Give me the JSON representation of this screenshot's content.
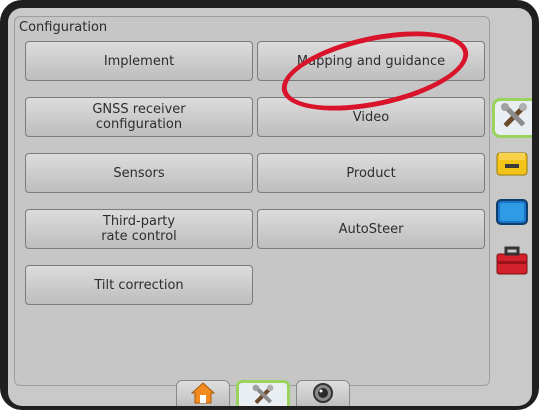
{
  "panel": {
    "title": "Configuration"
  },
  "buttons": {
    "implement": "Implement",
    "mapping": "Mapping and guidance",
    "gnss": "GNSS receiver\nconfiguration",
    "video": "Video",
    "sensors": "Sensors",
    "product": "Product",
    "third_party": "Third-party\nrate control",
    "autosteer": "AutoSteer",
    "tilt": "Tilt correction"
  },
  "side_tabs": [
    {
      "icon": "tools-icon",
      "active": true
    },
    {
      "icon": "tractor-icon",
      "active": false
    },
    {
      "icon": "monitor-icon",
      "active": false
    },
    {
      "icon": "toolbox-icon",
      "active": false
    }
  ],
  "bottom_tabs": [
    {
      "icon": "home-icon",
      "active": false
    },
    {
      "icon": "tools-icon",
      "active": true
    },
    {
      "icon": "camera-lens-icon",
      "active": false
    }
  ],
  "colors": {
    "highlight_green": "#9ad35e",
    "annotation_red": "#d8132a"
  }
}
